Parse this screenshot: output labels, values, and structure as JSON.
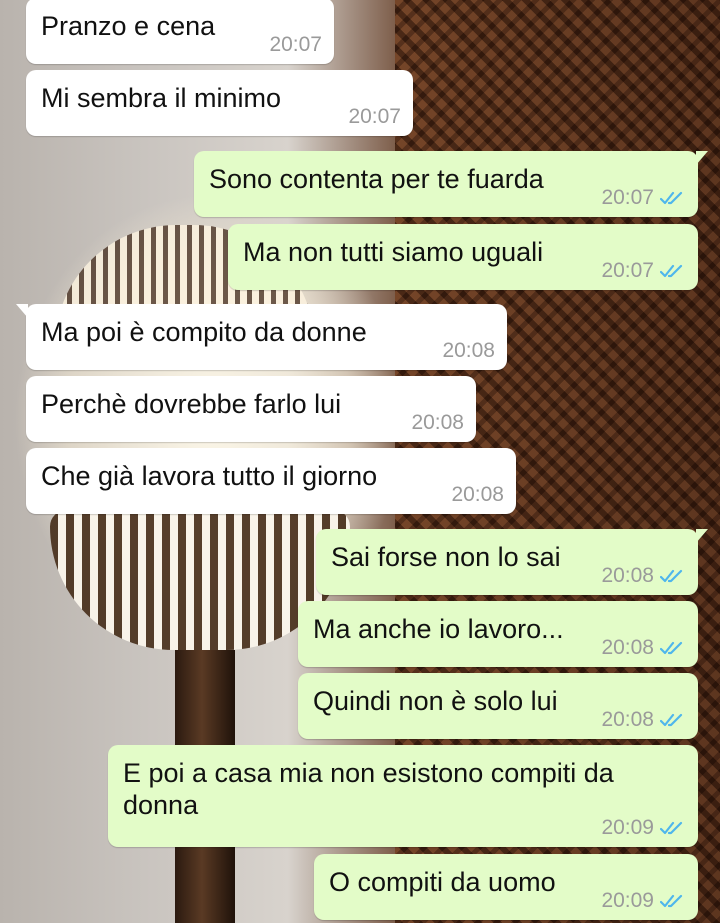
{
  "chat": {
    "messages": [
      {
        "text": "Pranzo e cena",
        "time": "20:07",
        "dir": "in"
      },
      {
        "text": "Mi sembra il minimo",
        "time": "20:07",
        "dir": "in"
      },
      {
        "text": "Sono contenta per te fuarda",
        "time": "20:07",
        "dir": "out",
        "status": "read"
      },
      {
        "text": "Ma non tutti siamo uguali",
        "time": "20:07",
        "dir": "out",
        "status": "read"
      },
      {
        "text": "Ma poi è compito da donne",
        "time": "20:08",
        "dir": "in"
      },
      {
        "text": "Perchè dovrebbe farlo lui",
        "time": "20:08",
        "dir": "in"
      },
      {
        "text": "Che già lavora tutto il giorno",
        "time": "20:08",
        "dir": "in"
      },
      {
        "text": "Sai forse non lo sai",
        "time": "20:08",
        "dir": "out",
        "status": "read"
      },
      {
        "text": "Ma anche io lavoro...",
        "time": "20:08",
        "dir": "out",
        "status": "read"
      },
      {
        "text": "Quindi non è solo lui",
        "time": "20:08",
        "dir": "out",
        "status": "read"
      },
      {
        "text": "E poi a casa mia non esistono compiti da donna",
        "time": "20:09",
        "dir": "out",
        "status": "read"
      },
      {
        "text": "O compiti da uomo",
        "time": "20:09",
        "dir": "out",
        "status": "read"
      }
    ]
  },
  "colors": {
    "incoming_bubble": "#ffffff",
    "outgoing_bubble": "#e3fcc8",
    "read_ticks": "#4fb6ec",
    "timestamp": "#9a9a9a"
  },
  "icons": {
    "read_receipt": "double-check-icon"
  }
}
